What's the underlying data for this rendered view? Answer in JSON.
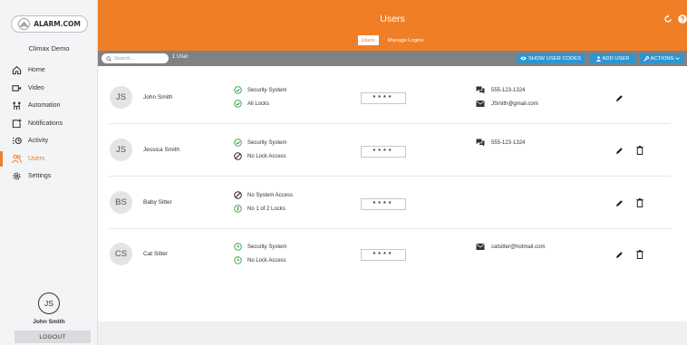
{
  "brand": {
    "logo_text": "ALARM.COM",
    "account_name": "Climax Demo"
  },
  "sidebar": {
    "items": [
      {
        "label": "Home",
        "icon": "home-icon"
      },
      {
        "label": "Video",
        "icon": "video-icon"
      },
      {
        "label": "Automation",
        "icon": "automation-icon"
      },
      {
        "label": "Notifications",
        "icon": "notifications-icon"
      },
      {
        "label": "Activity",
        "icon": "activity-icon"
      },
      {
        "label": "Users",
        "icon": "users-icon",
        "active": true
      },
      {
        "label": "Settings",
        "icon": "settings-icon"
      }
    ],
    "user_initials": "JS",
    "user_name": "John Smith",
    "logout_label": "LOGOUT"
  },
  "header": {
    "title": "Users",
    "tabs": [
      {
        "label": "Users",
        "active": true
      },
      {
        "label": "Manage Logins",
        "active": false
      }
    ],
    "icons": [
      "refresh-icon",
      "help-icon"
    ]
  },
  "toolbar": {
    "search_placeholder": "Search...",
    "user_count": "1 User",
    "show_codes_label": "SHOW USER CODES",
    "add_user_label": "ADD USER",
    "actions_label": "ACTIONS"
  },
  "users": [
    {
      "initials": "JS",
      "name": "John Smith",
      "access": [
        {
          "text": "Security System",
          "status": "check"
        },
        {
          "text": "All Locks",
          "status": "check"
        }
      ],
      "pin": "****",
      "contacts": [
        {
          "type": "phone",
          "value": "555-123-1324"
        },
        {
          "type": "email",
          "value": "JSmith@gmail.com"
        }
      ],
      "deletable": false
    },
    {
      "initials": "JS",
      "name": "Jessica Smith",
      "access": [
        {
          "text": "Security System",
          "status": "check"
        },
        {
          "text": "No Lock Access",
          "status": "none"
        }
      ],
      "pin": "****",
      "contacts": [
        {
          "type": "phone",
          "value": "555-123-1324"
        }
      ],
      "deletable": true
    },
    {
      "initials": "BS",
      "name": "Baby Sitter",
      "access": [
        {
          "text": "No System Access",
          "status": "none"
        },
        {
          "text": "No 1 of 2 Locks",
          "status": "partial"
        }
      ],
      "pin": "****",
      "contacts": [],
      "deletable": true
    },
    {
      "initials": "CS",
      "name": "Cat Sitter",
      "access": [
        {
          "text": "Security System",
          "status": "scheduled"
        },
        {
          "text": "No Lock Access",
          "status": "scheduled"
        }
      ],
      "pin": "****",
      "contacts": [
        {
          "type": "email",
          "value": "catsitter@hotmail.com"
        }
      ],
      "deletable": true
    }
  ],
  "colors": {
    "accent": "#f07e26",
    "button_blue": "#2f95cf",
    "toolbar_gray": "#7f8185",
    "status_green": "#2e9e3a"
  }
}
